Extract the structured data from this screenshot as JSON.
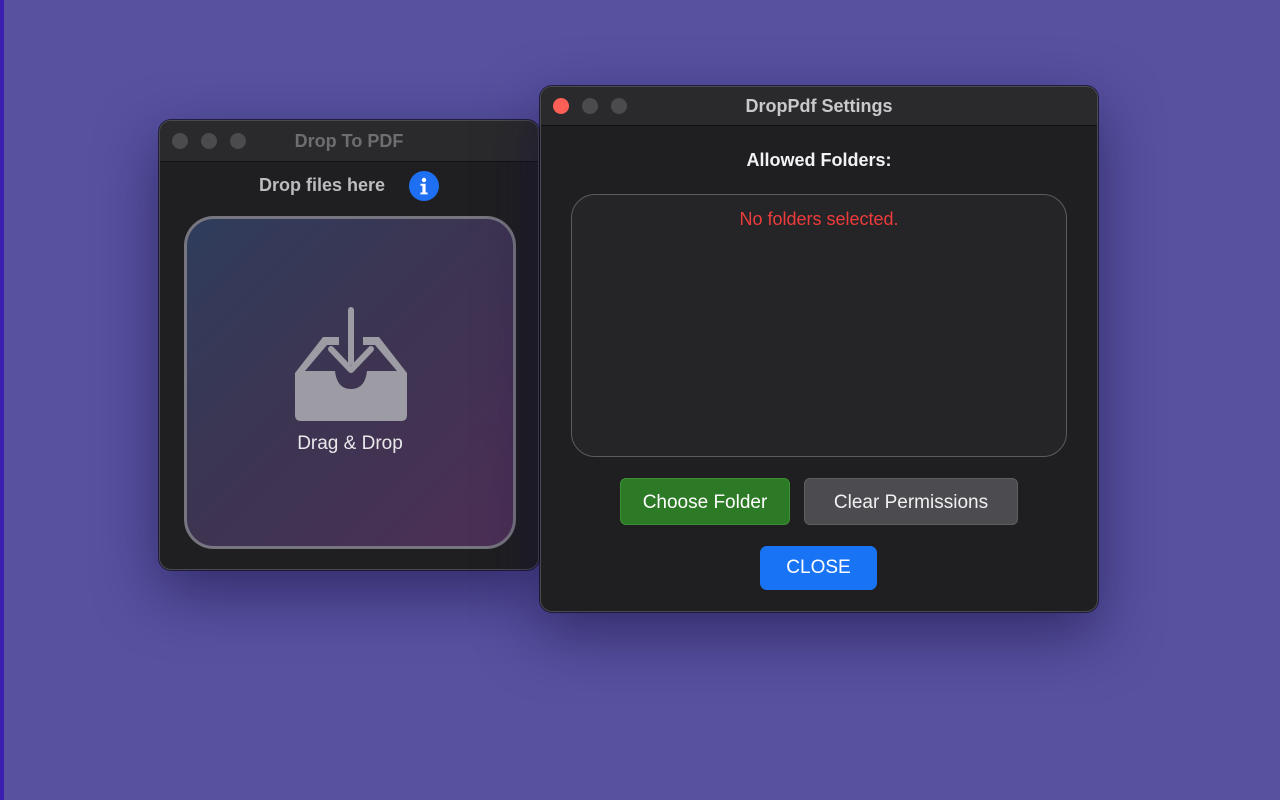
{
  "desktop": {
    "background_color": "#5751a0"
  },
  "drop_window": {
    "title": "Drop To PDF",
    "heading": "Drop files here",
    "info_icon": "info-icon",
    "drop_zone_label": "Drag & Drop",
    "drop_zone_icon": "tray-download-icon"
  },
  "settings_window": {
    "title": "DropPdf Settings",
    "section_label": "Allowed Folders:",
    "empty_message": "No folders selected.",
    "buttons": {
      "choose_folder": "Choose Folder",
      "clear_permissions": "Clear Permissions",
      "close": "CLOSE"
    },
    "colors": {
      "empty_message": "#ee3b3b",
      "choose_folder": "#2d7a26",
      "clear_permissions": "#4c4c50",
      "close": "#1974f5",
      "close_traffic_light": "#fe5f57"
    }
  }
}
